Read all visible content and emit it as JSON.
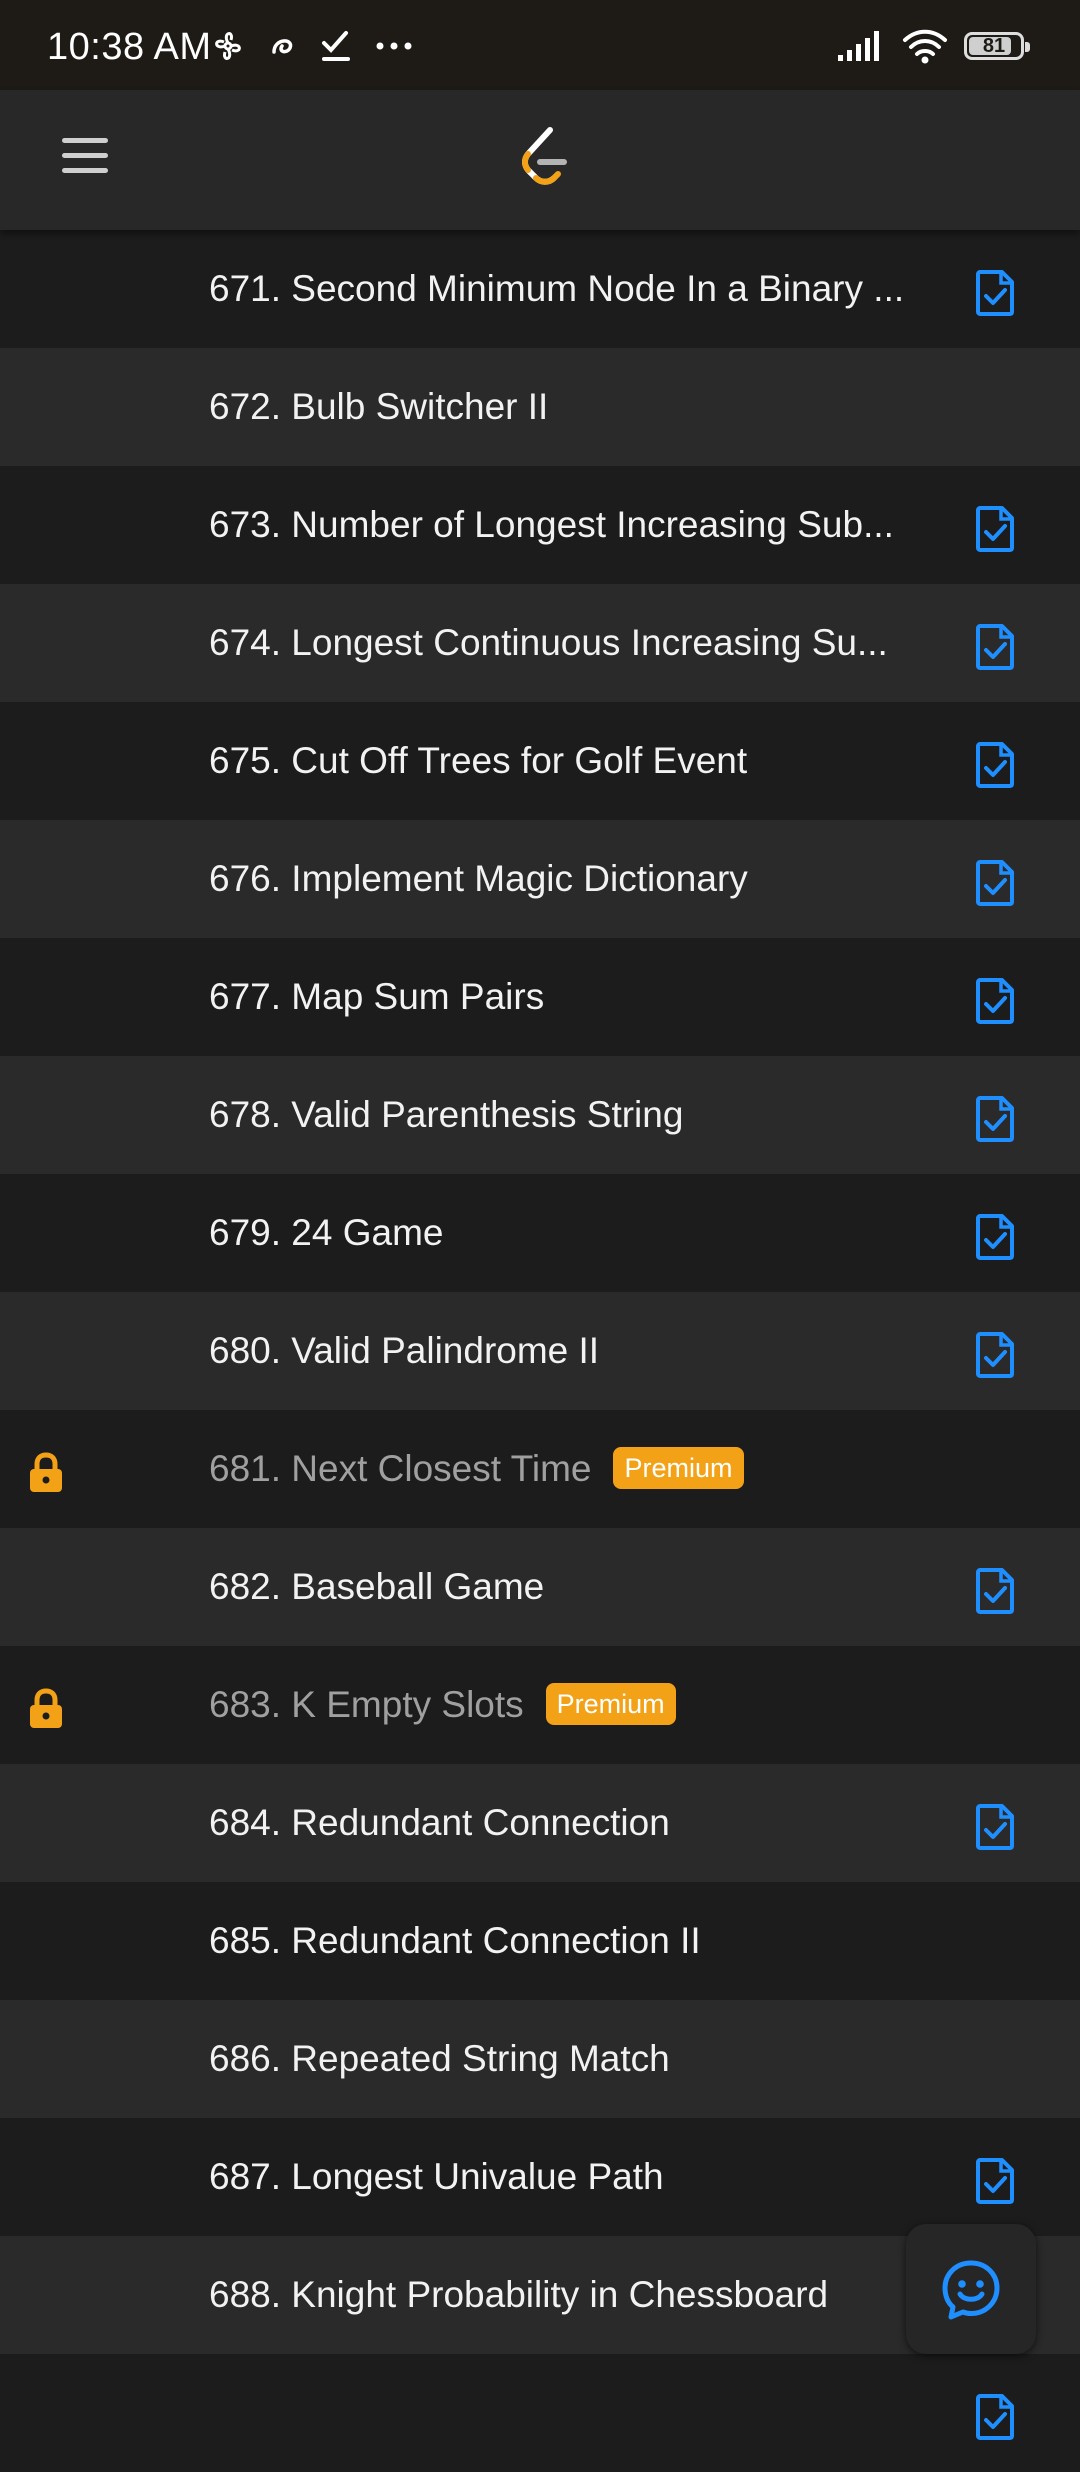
{
  "status_bar": {
    "time": "10:38 AM",
    "battery_level": "81",
    "left_icons": [
      "fan-icon",
      "swirl-icon",
      "check-icon",
      "more-icon"
    ],
    "right_icons": [
      "signal-icon",
      "wifi-icon",
      "battery-icon"
    ]
  },
  "header": {
    "menu_icon": "hamburger-menu-icon",
    "logo_icon": "leetcode-logo"
  },
  "colors": {
    "accent_blue": "#1f8fff",
    "premium_orange": "#f3a217",
    "row_dark": "#1c1c1c",
    "row_light": "#2a2a2a"
  },
  "problems": [
    {
      "title": "671. Second Minimum Node In a Binary ...",
      "solution": true,
      "locked": false
    },
    {
      "title": "672. Bulb Switcher II",
      "solution": false,
      "locked": false
    },
    {
      "title": "673. Number of Longest Increasing Sub...",
      "solution": true,
      "locked": false
    },
    {
      "title": "674. Longest Continuous Increasing Su...",
      "solution": true,
      "locked": false
    },
    {
      "title": "675. Cut Off Trees for Golf Event",
      "solution": true,
      "locked": false
    },
    {
      "title": "676. Implement Magic Dictionary",
      "solution": true,
      "locked": false
    },
    {
      "title": "677. Map Sum Pairs",
      "solution": true,
      "locked": false
    },
    {
      "title": "678. Valid Parenthesis String",
      "solution": true,
      "locked": false
    },
    {
      "title": "679. 24 Game",
      "solution": true,
      "locked": false
    },
    {
      "title": "680. Valid Palindrome II",
      "solution": true,
      "locked": false
    },
    {
      "title": "681. Next Closest Time",
      "solution": false,
      "locked": true,
      "badge": "Premium"
    },
    {
      "title": "682. Baseball Game",
      "solution": true,
      "locked": false
    },
    {
      "title": "683. K Empty Slots",
      "solution": false,
      "locked": true,
      "badge": "Premium"
    },
    {
      "title": "684. Redundant Connection",
      "solution": true,
      "locked": false
    },
    {
      "title": "685. Redundant Connection II",
      "solution": false,
      "locked": false
    },
    {
      "title": "686. Repeated String Match",
      "solution": false,
      "locked": false
    },
    {
      "title": "687. Longest Univalue Path",
      "solution": true,
      "locked": false
    },
    {
      "title": "688. Knight Probability in Chessboard",
      "solution": false,
      "locked": false
    },
    {
      "title": "",
      "solution": true,
      "locked": false
    }
  ],
  "fab": {
    "icon": "chat-smile-icon"
  }
}
